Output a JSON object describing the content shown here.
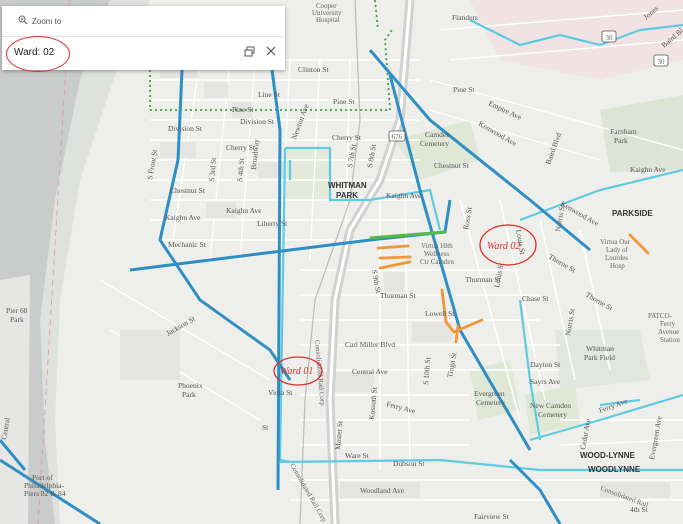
{
  "popup": {
    "zoom_label": "Zoom to",
    "title": "Ward: 02",
    "zoom_icon": "zoom-magnifier-icon",
    "dock_icon": "dock-icon",
    "close_icon": "close-icon"
  },
  "annotations": {
    "ward_a": "Ward 02",
    "ward_b": "Ward 01"
  },
  "colors": {
    "ward_boundary": "#2f8fc4",
    "district_boundary": "#5fcbe0",
    "green_dotted": "#3aa63a",
    "orange_segments": "#f2963a",
    "green_segment": "#55b847",
    "annotation_red": "#d9302c",
    "river": "#c9ccca"
  },
  "map_labels": {
    "cooper": "Cooper",
    "university": "University",
    "hospital": "Hospital",
    "clinton": "Clinton St",
    "line": "Line St",
    "pine_w": "Pine St",
    "pine_c": "Pine St",
    "pine_e": "Pine St",
    "division_w": "Division St",
    "division_c": "Division St",
    "cherry_w": "Cherry St",
    "cherry_c": "Cherry St",
    "chestnut_w": "Chestnut St",
    "chestnut_e": "Chestnut St",
    "kaighn_w": "Kaighn Ave",
    "kaighn_c": "Kaighn Ave",
    "kaighn_e": "Kaighn Ave",
    "kaighn_far": "Kaighn Ave",
    "mechanic": "Mechanic St",
    "liberty": "Liberty St",
    "front": "S Front St",
    "s3rd": "S 3rd St",
    "s4th": "S 4th St",
    "broadway": "Broadway",
    "newton": "Newton Ave",
    "s7th": "S 7th St",
    "s8th": "S 8th St",
    "s9th": "S 9th St",
    "s10th": "S 10th St",
    "whitman": "WHITMAN",
    "park": "PARK",
    "camden": "Camden",
    "cemetery": "Cemetery",
    "empire": "Empire Ave",
    "kenwood_n": "Kenwood Ave",
    "kenwood_s": "Kenwood Ave",
    "baird": "Baird Blvd",
    "farnham": "Farnham",
    "farnham_park": "Park",
    "parkside": "PARKSIDE",
    "virtua1": "Virtua Hlth",
    "virtua2": "Wellness",
    "virtua3": "Ctr Camden",
    "virtua_our1": "Virtua Our",
    "virtua_our2": "Lady of",
    "virtua_our3": "Lourdes",
    "virtua_our4": "Hosp",
    "thurman_w": "Thurman St",
    "thurman_e": "Thurman St",
    "chase": "Chase St",
    "lowell": "Lowell St",
    "louis_n": "Louis St",
    "louis_s": "Louis St",
    "ross": "Ross St",
    "norris_n": "Norris St",
    "norris_s": "Norris St",
    "thorne_n": "Thorne St",
    "thorne_s": "Thorne St",
    "jackson": "Jackson St",
    "carl_miller": "Carl Miller Blvd",
    "central": "Central Ave",
    "ferry_c": "Ferry Ave",
    "ferry_e": "Ferry Ave",
    "dayton": "Dayton St",
    "sayrs": "Sayrs Ave",
    "tioga": "Tioga St",
    "evergreen1": "Evergreen",
    "evergreen2": "Cemetery",
    "new_camden1": "New Camden",
    "new_camden2": "Cemetery",
    "whitman_field1": "Whitman",
    "whitman_field2": "Park Field",
    "patco1": "PATCO-",
    "patco2": "Ferry",
    "patco3": "Avenue",
    "patco4": "Station",
    "phoenix1": "Phoenix",
    "phoenix2": "Park",
    "viola": "Viola St",
    "master": "Master St",
    "kossuth": "Kossuth St",
    "ware": "Ware St",
    "dubson": "Dubson St",
    "woodland": "Woodland Ave",
    "fairview": "Fairview St",
    "conrail1": "Consolidated Rail Corp",
    "conrail2": "Consolidated Rail Corp",
    "conrail3": "Consolidated Rail",
    "woodlynne1": "WOOD-LYNNE",
    "woodlynne2": "WOODLYNNE",
    "cedar": "Cedar Ave",
    "evergreen_ave": "Evergreen Ave",
    "fourth": "4th St",
    "pier1": "Pier 68",
    "pier2": "Park",
    "port1": "Port of",
    "port2": "Philadelphia-",
    "port3": "Piers 82 & 84",
    "central_w": "Central",
    "route30": "30",
    "route676": "676",
    "jones": "Jones",
    "baird_ne": "Baird Bl",
    "flanders": "Flanders",
    "south_st": "St"
  }
}
